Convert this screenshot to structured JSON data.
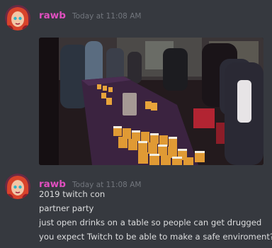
{
  "messages": [
    {
      "username": "rawb",
      "timestamp": "Today at 11:08 AM",
      "attachment": {
        "kind": "image",
        "subject": "party-table-with-open-drinks-photo"
      }
    },
    {
      "username": "rawb",
      "timestamp": "Today at 11:08 AM",
      "lines": [
        "2019 twitch con",
        "partner party",
        "just open drinks on a table so people can get drugged",
        "you expect Twitch to be able to make a safe enviroment?"
      ]
    }
  ],
  "colors": {
    "background": "#36393f",
    "username": "#e04fbf",
    "timestamp": "#72767d",
    "text": "#dcddde"
  }
}
